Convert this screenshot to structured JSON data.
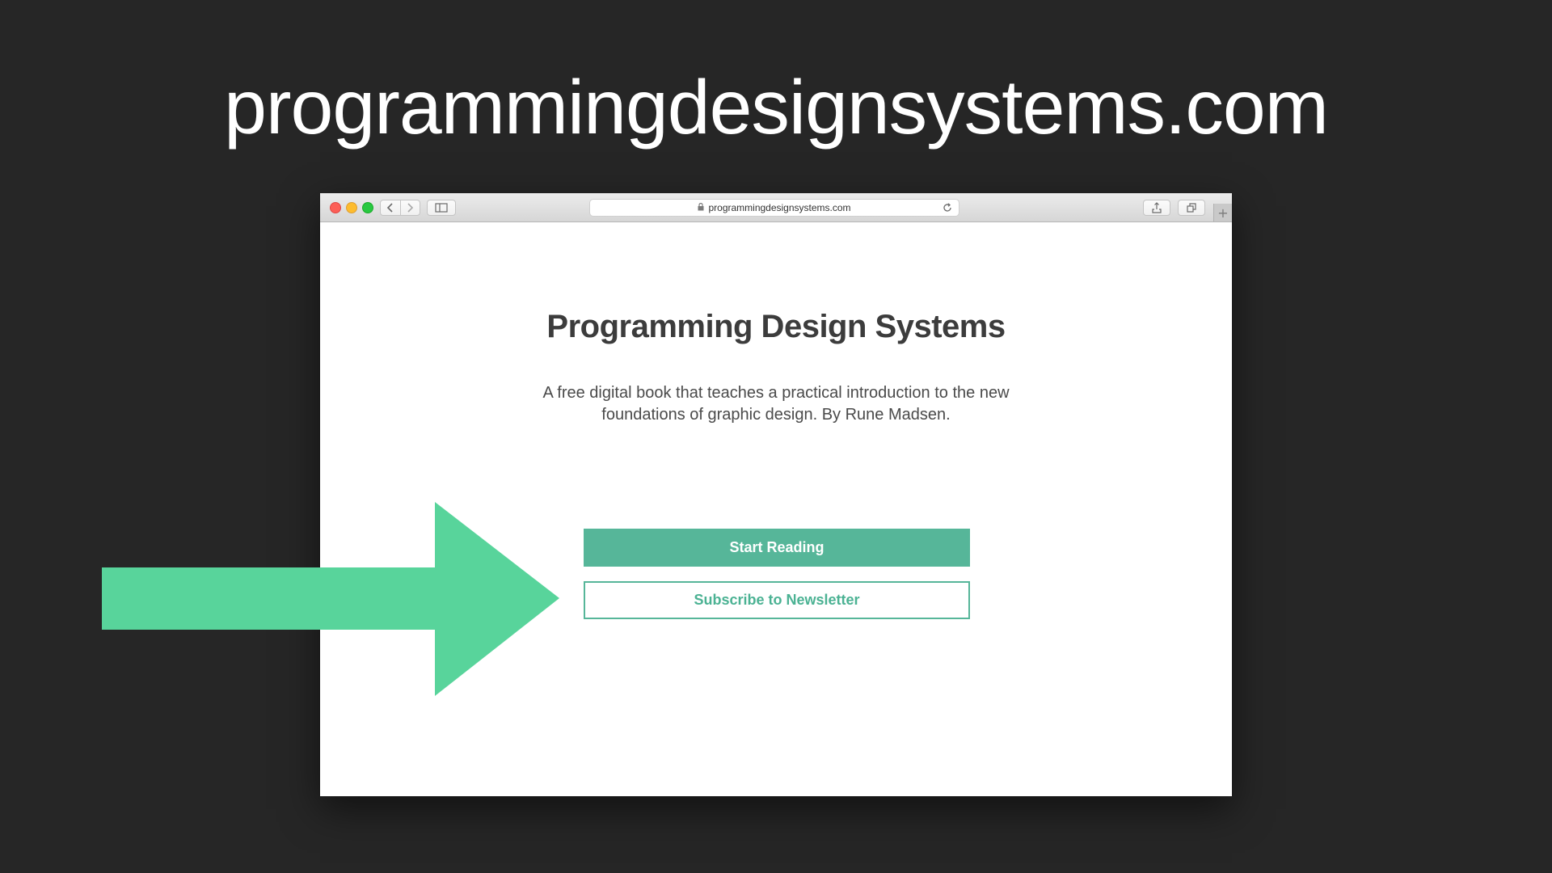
{
  "slide": {
    "title": "programmingdesignsystems.com"
  },
  "browser": {
    "url": "programmingdesignsystems.com",
    "icons": {
      "back": "chevron-left-icon",
      "forward": "chevron-right-icon",
      "sidebar": "sidebar-icon",
      "lock": "lock-icon",
      "reload": "reload-icon",
      "share": "share-icon",
      "tabs": "tabs-overview-icon",
      "new_tab": "plus-icon"
    },
    "new_tab_label": "+"
  },
  "page": {
    "heading": "Programming Design Systems",
    "description": "A free digital book that teaches a practical introduction to the new foundations of graphic design. By Rune Madsen.",
    "primary_button": "Start Reading",
    "secondary_button": "Subscribe to Newsletter"
  },
  "colors": {
    "background": "#262626",
    "accent": "#56b699",
    "arrow": "#58d49b"
  },
  "annotation": {
    "icon": "arrow-right-icon"
  }
}
